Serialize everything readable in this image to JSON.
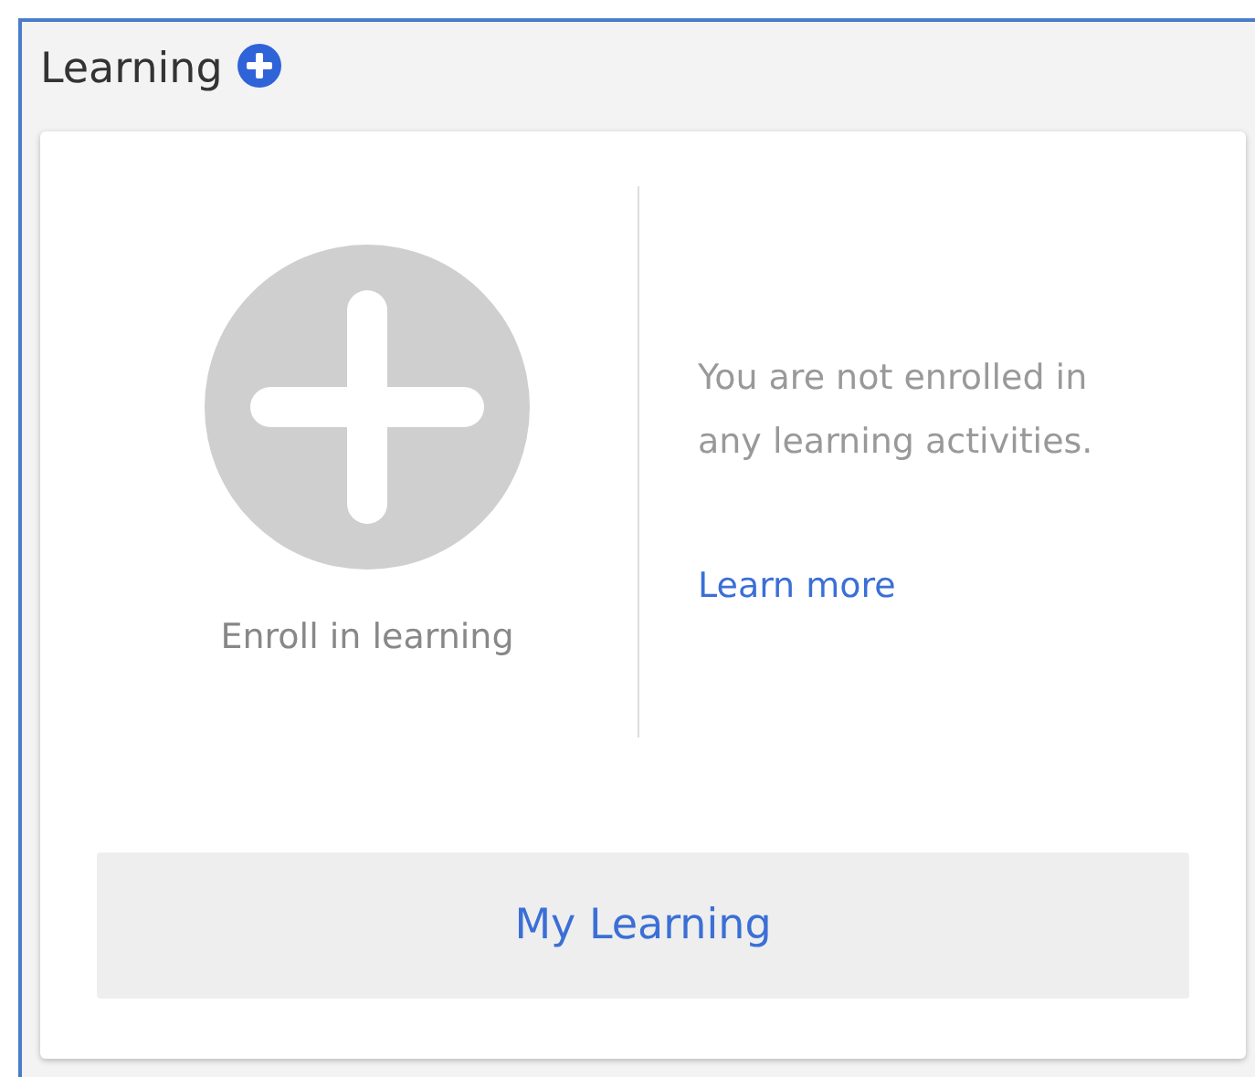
{
  "panel": {
    "title": "Learning"
  },
  "enroll": {
    "label": "Enroll in learning"
  },
  "message": {
    "text": "You are not enrolled in any learning activities.",
    "link": "Learn more"
  },
  "button": {
    "label": "My Learning"
  }
}
